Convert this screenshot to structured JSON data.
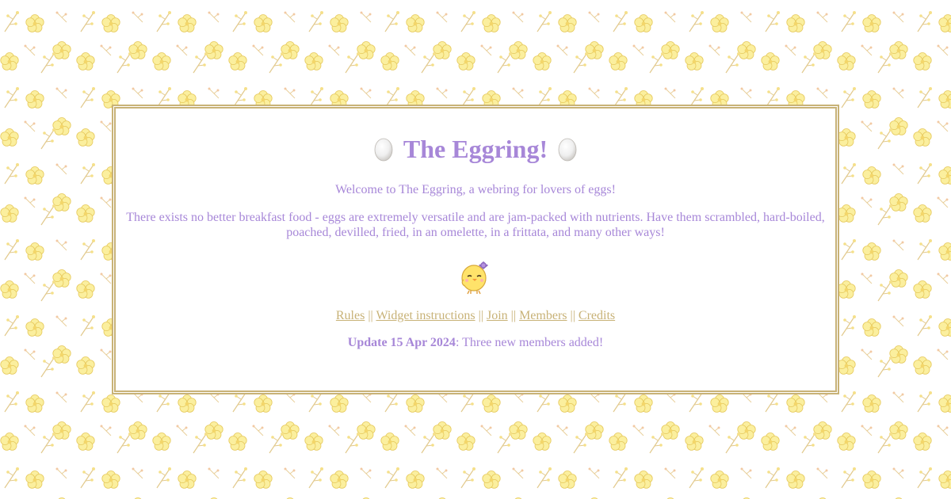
{
  "header": {
    "title": "The Eggring!",
    "left_icon": "egg-icon",
    "right_icon": "egg-icon"
  },
  "intro": {
    "welcome": "Welcome to The Eggring, a webring for lovers of eggs!",
    "description": "There exists no better breakfast food - eggs are extremely versatile and are jam-packed with nutrients. Have them scrambled, hard-boiled, poached, devilled, fried, in an omelette, in a frittata, and many other ways!"
  },
  "mascot": {
    "icon": "chick-icon"
  },
  "nav": {
    "links": [
      {
        "label": "Rules"
      },
      {
        "label": "Widget instructions"
      },
      {
        "label": "Join"
      },
      {
        "label": "Members"
      },
      {
        "label": "Credits"
      }
    ],
    "separator": "||"
  },
  "update": {
    "date_label": "Update 15 Apr 2024",
    "message": ": Three new members added!"
  },
  "colors": {
    "text_purple": "#a787d8",
    "link_gold": "#c8b277",
    "border_gold": "#c8b277",
    "flower_yellow": "#f7e58a",
    "branch_tan": "#e3c98a"
  }
}
